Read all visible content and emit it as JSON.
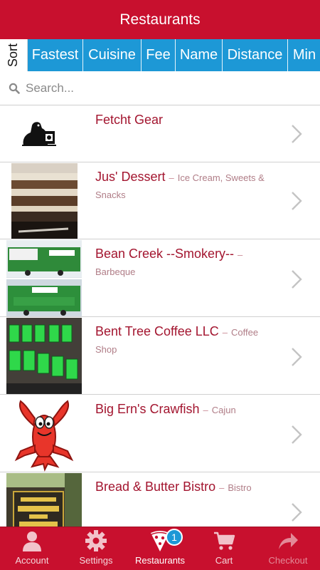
{
  "header": {
    "title": "Restaurants"
  },
  "sort": {
    "label": "Sort",
    "options": [
      "Fastest",
      "Cuisine",
      "Fee",
      "Name",
      "Distance",
      "Min"
    ]
  },
  "search": {
    "placeholder": "Search...",
    "icon": "search-icon"
  },
  "restaurants": [
    {
      "name": "Fetcht Gear",
      "category": "",
      "image": "fetcht-gear-logo"
    },
    {
      "name": "Jus' Dessert",
      "category": "Ice Cream, Sweets & Snacks",
      "image": "dessert-photo"
    },
    {
      "name": "Bean Creek --Smokery--",
      "category": "Barbeque",
      "image": "food-truck-photo"
    },
    {
      "name": "Bent Tree Coffee LLC",
      "category": "Coffee Shop",
      "image": "bent-tree-coffee-sign"
    },
    {
      "name": "Big Ern's Crawfish",
      "category": "Cajun",
      "image": "crawfish-logo"
    },
    {
      "name": "Bread & Butter Bistro",
      "category": "Bistro",
      "image": "bread-butter-sign"
    }
  ],
  "separator": "–",
  "tabs": [
    {
      "label": "Account",
      "icon": "person-icon"
    },
    {
      "label": "Settings",
      "icon": "gear-icon"
    },
    {
      "label": "Restaurants",
      "icon": "pizza-icon",
      "badge": "1"
    },
    {
      "label": "Cart",
      "icon": "cart-icon"
    },
    {
      "label": "Checkout",
      "icon": "share-arrow-icon"
    }
  ],
  "colors": {
    "brand_red": "#c8102e",
    "sort_blue": "#1d98d6",
    "name_text": "#a3152f"
  }
}
